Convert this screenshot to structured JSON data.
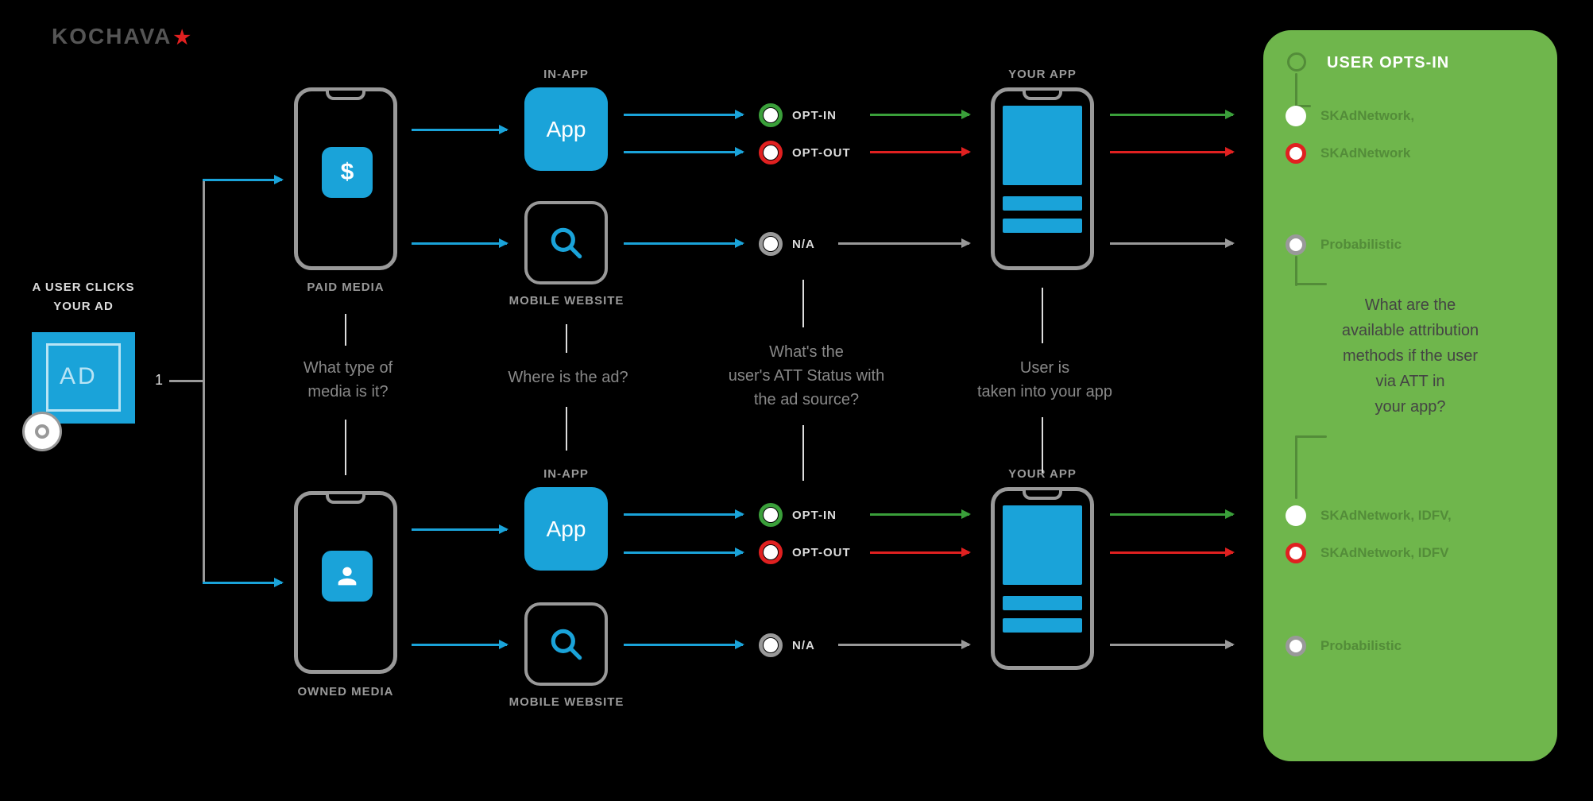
{
  "logo": {
    "name": "KOCHAVA",
    "star": "★"
  },
  "start": {
    "line1": "A USER CLICKS",
    "line2": "YOUR AD",
    "ad_label": "AD",
    "one": "1"
  },
  "media": {
    "paid_label": "PAID MEDIA",
    "owned_label": "OWNED MEDIA",
    "question": "What type of\nmedia is it?",
    "dollar": "$"
  },
  "source": {
    "inapp_label": "IN-APP",
    "inapp_text": "App",
    "website_label": "MOBILE WEBSITE",
    "question": "Where is the ad?"
  },
  "att": {
    "optin": "OPT-IN",
    "optout": "OPT-OUT",
    "na": "N/A",
    "question": "What's the\nuser's ATT Status with\nthe ad source?"
  },
  "yourapp": {
    "label": "YOUR APP",
    "question": "User is\ntaken into your app"
  },
  "right_panel": {
    "title": "USER OPTS-IN",
    "rows_top": [
      {
        "dot": "white",
        "text": "SKAdNetwork,"
      },
      {
        "dot": "red",
        "text": "SKAdNetwork"
      },
      {
        "dot": "gray",
        "text": "Probabilistic"
      }
    ],
    "question": "What are the\navailable attribution\nmethods if the user\nvia ATT in\nyour app?",
    "rows_bottom": [
      {
        "dot": "white",
        "text": "SKAdNetwork, IDFV,"
      },
      {
        "dot": "red",
        "text": "SKAdNetwork, IDFV"
      },
      {
        "dot": "gray",
        "text": "Probabilistic"
      }
    ]
  }
}
